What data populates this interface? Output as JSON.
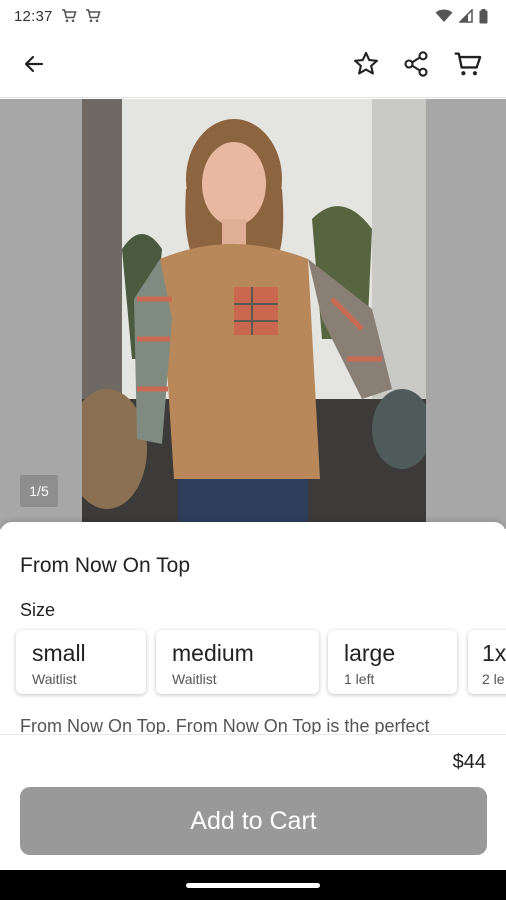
{
  "status_bar": {
    "time": "12:37"
  },
  "app_bar": {
    "icons": [
      "arrow-left-icon",
      "star-outline-icon",
      "share-icon",
      "cart-icon"
    ]
  },
  "gallery": {
    "page_indicator": "1/5",
    "background_color": "#a7a7a7"
  },
  "product": {
    "title": "From Now On Top",
    "size_label": "Size",
    "sizes": [
      {
        "name": "small",
        "status": "Waitlist"
      },
      {
        "name": "medium",
        "status": "Waitlist"
      },
      {
        "name": "large",
        "status": "1 left"
      },
      {
        "name": "1x",
        "status": "2 le"
      }
    ],
    "description": "From Now On Top. From Now On Top is the perfect",
    "price": "$44"
  },
  "actions": {
    "add_to_cart_label": "Add to Cart",
    "button_color": "#999999"
  }
}
